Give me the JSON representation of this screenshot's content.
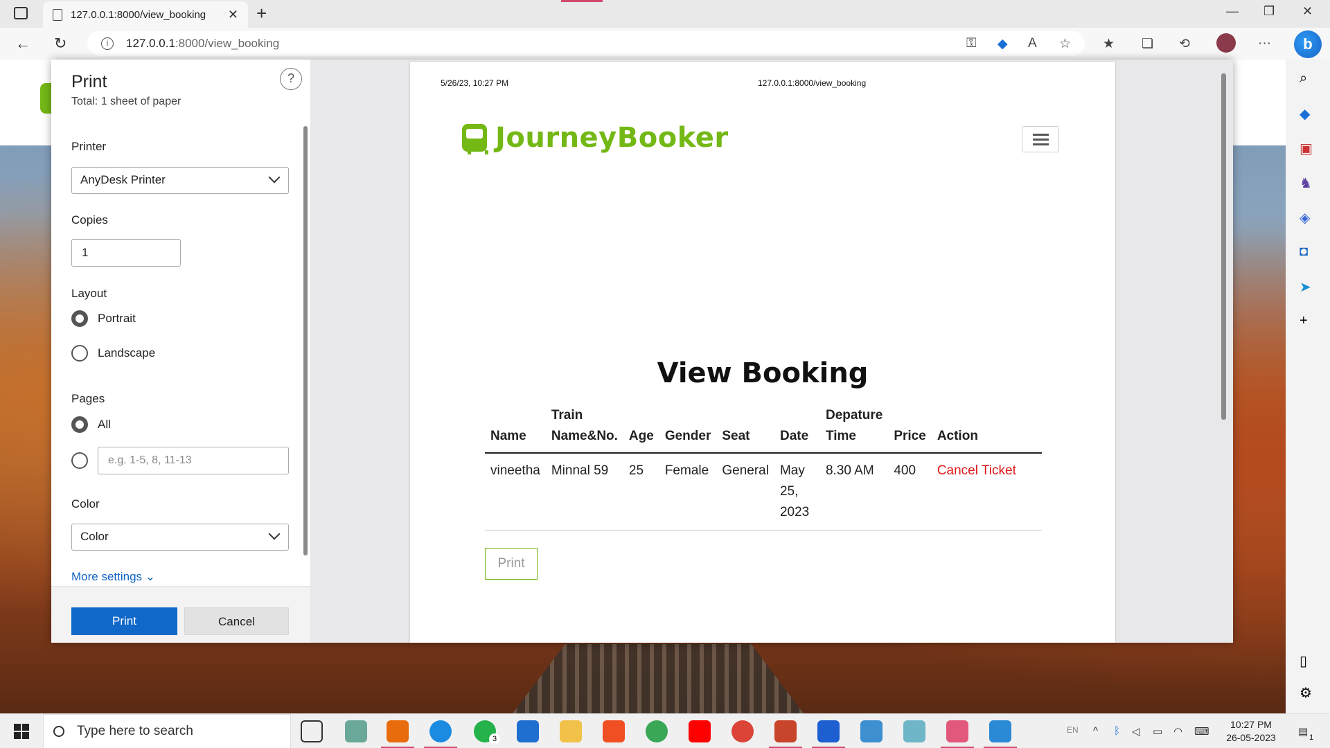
{
  "browser": {
    "tab_title": "127.0.0.1:8000/view_booking",
    "close_tab_glyph": "✕",
    "new_tab_glyph": "+",
    "address_host": "127.0.0.1",
    "address_rest": ":8000/view_booking",
    "window_min": "—",
    "window_restore": "❐",
    "window_close": "✕",
    "back_glyph": "←",
    "refresh_glyph": "↻",
    "info_glyph": "i",
    "bing_glyph": "b",
    "more_glyph": "···"
  },
  "print_dialog": {
    "title": "Print",
    "subtitle": "Total: 1 sheet of paper",
    "help_glyph": "?",
    "printer_label": "Printer",
    "printer_value": "AnyDesk Printer",
    "copies_label": "Copies",
    "copies_value": "1",
    "layout_label": "Layout",
    "layout_options": [
      "Portrait",
      "Landscape"
    ],
    "layout_selected": "Portrait",
    "pages_label": "Pages",
    "pages_all": "All",
    "pages_placeholder": "e.g. 1-5, 8, 11-13",
    "color_label": "Color",
    "color_value": "Color",
    "more_settings": "More settings",
    "more_chevron": "⌄",
    "print_button": "Print",
    "cancel_button": "Cancel"
  },
  "preview": {
    "header_date": "5/26/23, 10:27 PM",
    "header_url": "127.0.0.1:8000/view_booking",
    "brand": "JourneyBooker",
    "page_title": "View Booking",
    "table_headers": [
      "Name",
      "Train Name&No.",
      "Age",
      "Gender",
      "Seat",
      "Date",
      "Depature Time",
      "Price",
      "Action"
    ],
    "rows": [
      {
        "name": "vineetha",
        "train": "Minnal 59",
        "age": "25",
        "gender": "Female",
        "seat": "General",
        "date": "May 25, 2023",
        "time": "8.30 AM",
        "price": "400",
        "action": "Cancel Ticket"
      }
    ],
    "print_button": "Print",
    "accent_color": "#74b816",
    "cancel_color": "#e01818"
  },
  "taskbar": {
    "search_placeholder": "Type here to search",
    "time": "10:27 PM",
    "date": "26-05-2023",
    "lang": "EN",
    "whatsapp_badge": "3",
    "notif_badge": "1"
  }
}
